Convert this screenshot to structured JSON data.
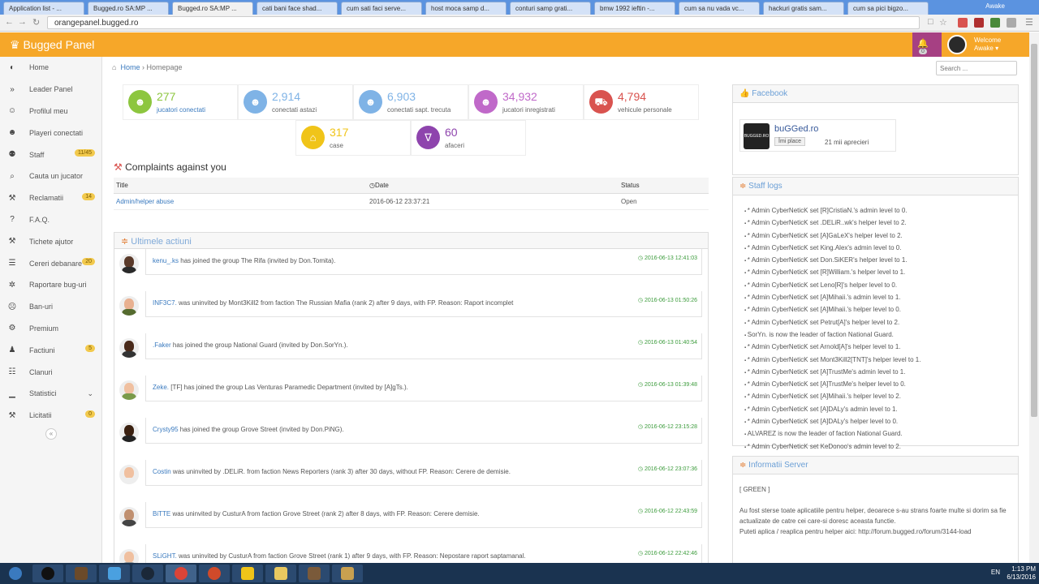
{
  "browser": {
    "tabs": [
      "Application list - ...",
      "Bugged.ro SA:MP ...",
      "Bugged.ro SA:MP ...",
      "cati bani face shad...",
      "cum sati faci serve...",
      "host moca samp d...",
      "conturi samp grati...",
      "bmw 1992 ieftin -...",
      "cum sa nu vada vc...",
      "hackuri gratis sam...",
      "cum sa pici bigzo..."
    ],
    "active_tab": 2,
    "window_user": "Awake",
    "url": "orangepanel.bugged.ro"
  },
  "header": {
    "brand": "Bugged Panel",
    "notifications": "0",
    "welcome": "Welcome",
    "username": "Awake"
  },
  "sidebar": {
    "items": [
      {
        "label": "Home",
        "icon": "dashboard-icon",
        "badge": ""
      },
      {
        "label": "Leader Panel",
        "icon": "double-chevron-icon",
        "badge": ""
      },
      {
        "label": "Profilul meu",
        "icon": "smile-icon",
        "badge": ""
      },
      {
        "label": "Playeri conectati",
        "icon": "user-icon",
        "badge": ""
      },
      {
        "label": "Staff",
        "icon": "android-icon",
        "badge": "11/45"
      },
      {
        "label": "Cauta un jucator",
        "icon": "search-icon",
        "badge": ""
      },
      {
        "label": "Reclamatii",
        "icon": "gavel-icon",
        "badge": "14"
      },
      {
        "label": "F.A.Q.",
        "icon": "question-icon",
        "badge": ""
      },
      {
        "label": "Tichete ajutor",
        "icon": "wrench-icon",
        "badge": ""
      },
      {
        "label": "Cereri debanare",
        "icon": "list-icon",
        "badge": "20"
      },
      {
        "label": "Raportare bug-uri",
        "icon": "bug-icon",
        "badge": ""
      },
      {
        "label": "Ban-uri",
        "icon": "frown-icon",
        "badge": ""
      },
      {
        "label": "Premium",
        "icon": "gear-icon",
        "badge": ""
      },
      {
        "label": "Factiuni",
        "icon": "users-icon",
        "badge": "5"
      },
      {
        "label": "Clanuri",
        "icon": "sitemap-icon",
        "badge": ""
      },
      {
        "label": "Statistici",
        "icon": "bar-chart-icon",
        "badge": ""
      },
      {
        "label": "Licitatii",
        "icon": "gavel-icon",
        "badge": "0"
      }
    ]
  },
  "breadcrumb": {
    "home": "Home",
    "current": "Homepage"
  },
  "search": {
    "placeholder": "Search ..."
  },
  "stats": [
    {
      "value": "277",
      "label": "jucatori conectati",
      "color": "#8dc63f",
      "icon": "user-icon"
    },
    {
      "value": "2,914",
      "label": "conectati astazi",
      "color": "#7fb3e6",
      "icon": "user-icon"
    },
    {
      "value": "6,903",
      "label": "conectati sapt. trecuta",
      "color": "#7fb3e6",
      "icon": "user-icon"
    },
    {
      "value": "34,932",
      "label": "jucatori inregistrati",
      "color": "#c069c9",
      "icon": "user-icon"
    },
    {
      "value": "4,794",
      "label": "vehicule personale",
      "color": "#d9534f",
      "icon": "truck-icon"
    },
    {
      "value": "317",
      "label": "case",
      "color": "#f0c419",
      "icon": "home-icon"
    },
    {
      "value": "60",
      "label": "afaceri",
      "color": "#8e44ad",
      "icon": "glass-icon"
    }
  ],
  "complaints": {
    "title": "Complaints against you",
    "columns": [
      "Title",
      "Date",
      "Status"
    ],
    "rows": [
      {
        "title": "Admin/helper abuse",
        "date": "2016-06-12 23:37:21",
        "status": "Open"
      }
    ]
  },
  "actions": {
    "title": "Ultimele actiuni",
    "items": [
      {
        "name": "kenu_.ks",
        "text": " has joined the group The Rifa (invited by Don.Tomita).",
        "time": "2016-06-13 12:41:03"
      },
      {
        "name": "INF3C7.",
        "text": " was uninvited by Mont3Kill2 from faction The Russian Mafia (rank 2) after 9 days, with FP. Reason: Raport incomplet",
        "time": "2016-06-13 01:50:26"
      },
      {
        "name": ".Faker",
        "text": " has joined the group National Guard (invited by Don.SorYn.).",
        "time": "2016-06-13 01:40:54"
      },
      {
        "name": "Zeke.",
        "text": " [TF] has joined the group Las Venturas Paramedic Department (invited by [A]gTs.).",
        "time": "2016-06-13 01:39:48"
      },
      {
        "name": "Crysty95",
        "text": " has joined the group Grove Street (invited by Don.PiNG).",
        "time": "2016-06-12 23:15:28"
      },
      {
        "name": "Costin",
        "text": " was uninvited by .DELiR. from faction News Reporters (rank 3) after 30 days, without FP. Reason: Cerere de demisie.",
        "time": "2016-06-12 23:07:36"
      },
      {
        "name": "BiTTE",
        "text": " was uninvited by CusturA from faction Grove Street (rank 2) after 8 days, with FP. Reason: Cerere demisie.",
        "time": "2016-06-12 22:43:59"
      },
      {
        "name": "SLiGHT.",
        "text": " was uninvited by CusturA from faction Grove Street (rank 1) after 9 days, with FP. Reason: Nepostare raport saptamanal.",
        "time": "2016-06-12 22:42:46"
      }
    ]
  },
  "facebook": {
    "title": "Facebook",
    "page": "buGGed.ro",
    "logo_text": "BUGGED.RO",
    "like": "Îmi place",
    "count": "21 mii aprecieri"
  },
  "staff_logs": {
    "title": "Staff logs",
    "items": [
      "* Admin CyberNeticK set [R]CristiaN.'s admin level to 0.",
      "* Admin CyberNeticK set .DELiR..wk's helper level to 2.",
      "* Admin CyberNeticK set [A]GaLeX's helper level to 2.",
      "* Admin CyberNeticK set King.Alex's admin level to 0.",
      "* Admin CyberNeticK set Don.SiKER's helper level to 1.",
      "* Admin CyberNeticK set [R]William.'s helper level to 1.",
      "* Admin CyberNeticK set Leno[R]'s helper level to 0.",
      "* Admin CyberNeticK set [A]Mihaii.'s admin level to 1.",
      "* Admin CyberNeticK set [A]Mihaii.'s helper level to 0.",
      "* Admin CyberNeticK set Petrut[A]'s helper level to 2.",
      "SorYn. is now the leader of faction National Guard.",
      "* Admin CyberNeticK set Arnold[A]'s helper level to 1.",
      "* Admin CyberNeticK set Mont3Kill2[TNT]'s helper level to 1.",
      "* Admin CyberNeticK set [A]TrustMe's admin level to 1.",
      "* Admin CyberNeticK set [A]TrustMe's helper level to 0.",
      "* Admin CyberNeticK set [A]Mihaii.'s helper level to 2.",
      "* Admin CyberNeticK set [A]DALy's admin level to 1.",
      "* Admin CyberNeticK set [A]DALy's helper level to 0.",
      "ALVAREZ is now the leader of faction National Guard.",
      "* Admin CyberNeticK set KeDonoo's admin level to 2."
    ]
  },
  "server_info": {
    "title": "Informatii Server",
    "tag": "[ GREEN ]",
    "line1": "Au fost sterse toate aplicatiile pentru helper, deoarece s-au strans foarte multe si dorim sa fie actualizate de catre cei care-si doresc aceasta functie.",
    "line2": "Puteti aplica / reaplica pentru helper aici: http://forum.bugged.ro/forum/3144-load"
  },
  "taskbar": {
    "lang": "EN",
    "time": "1:13 PM",
    "date": "6/13/2016"
  },
  "colors": {
    "accent": "#f6a729",
    "link": "#3a7abf",
    "notif": "#a64083",
    "time_green": "#3b9b3b"
  }
}
